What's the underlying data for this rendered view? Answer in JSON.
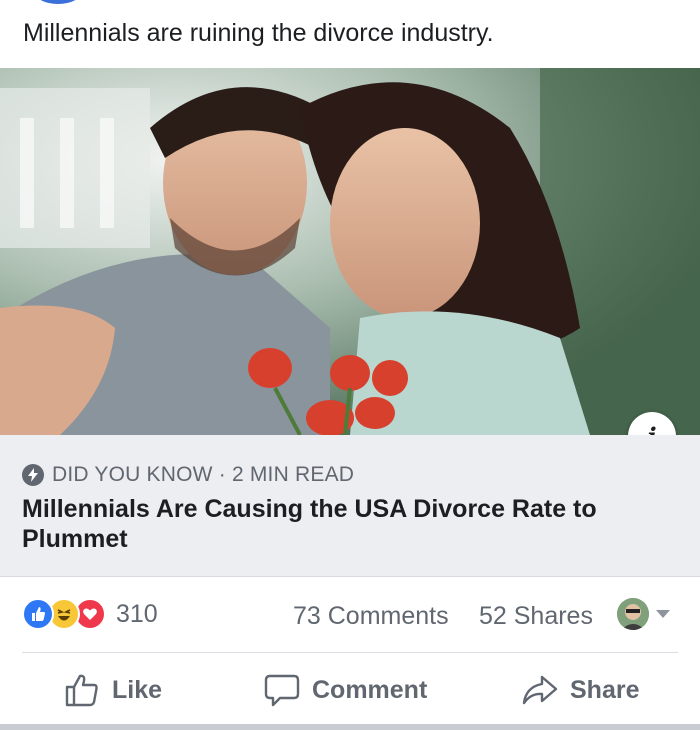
{
  "post": {
    "text": "Millennials are ruining the divorce industry."
  },
  "link_preview": {
    "image_icon": "couple-selfie-photo",
    "info_icon": "info-icon",
    "source_label": "DID YOU KNOW · 2 MIN READ",
    "title": "Millennials Are Causing the USA Divorce Rate to Plummet"
  },
  "stats": {
    "reactions": [
      "like",
      "haha",
      "love"
    ],
    "reaction_count": "310",
    "comments": "73 Comments",
    "shares": "52 Shares"
  },
  "actions": {
    "like_label": "Like",
    "comment_label": "Comment",
    "share_label": "Share"
  },
  "colors": {
    "like_blue": "#2e78f6",
    "haha_yellow": "#f7c738",
    "love_red": "#f0384c",
    "secondary_text": "#606770",
    "meta_background": "#eceef1"
  }
}
